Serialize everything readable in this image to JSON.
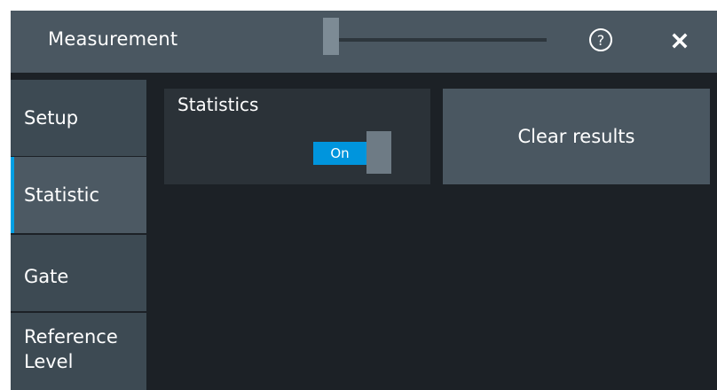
{
  "window": {
    "title": "Measurement"
  },
  "header": {
    "help_icon": "help-circle-icon",
    "close_icon": "close-icon"
  },
  "sidebar": {
    "items": [
      {
        "label": "Setup",
        "active": false
      },
      {
        "label": "Statistic",
        "active": true
      },
      {
        "label": "Gate",
        "active": false
      },
      {
        "label": "Reference Level",
        "active": false
      }
    ]
  },
  "statistics": {
    "label": "Statistics",
    "toggle_state": "On"
  },
  "actions": {
    "clear_label": "Clear results"
  },
  "colors": {
    "accent": "#009fe3",
    "toggle_on": "#0095dd",
    "panel_bg": "#1c2126",
    "titlebar_bg": "#4a5761"
  }
}
